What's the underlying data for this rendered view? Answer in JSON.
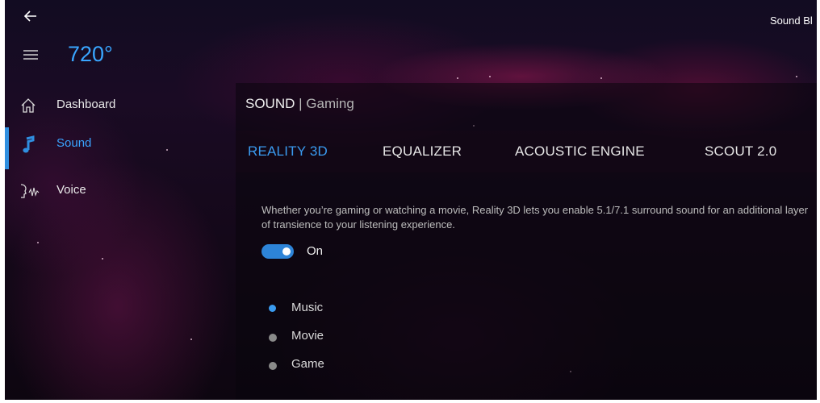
{
  "titlebar": {
    "app_title": "Sound Bl",
    "back_icon": "back-arrow-icon"
  },
  "header": {
    "brand": "720°",
    "menu_icon": "hamburger-menu-icon"
  },
  "sidebar": {
    "items": [
      {
        "label": "Dashboard",
        "icon": "home-icon",
        "active": false
      },
      {
        "label": "Sound",
        "icon": "music-note-icon",
        "active": true
      },
      {
        "label": "Voice",
        "icon": "voice-icon",
        "active": false
      }
    ]
  },
  "main": {
    "breadcrumb": {
      "section": "SOUND",
      "separator": "|",
      "profile": "Gaming"
    },
    "tabs": [
      {
        "label": "REALITY 3D",
        "active": true
      },
      {
        "label": "EQUALIZER",
        "active": false
      },
      {
        "label": "ACOUSTIC ENGINE",
        "active": false
      },
      {
        "label": "SCOUT 2.0",
        "active": false
      }
    ],
    "description": "Whether you’re gaming or watching a movie, Reality 3D lets you enable 5.1/7.1 surround sound for an additional layer of transience to your listening experience.",
    "toggle": {
      "state": "On",
      "on": true
    },
    "modes": [
      {
        "label": "Music",
        "selected": true
      },
      {
        "label": "Movie",
        "selected": false
      },
      {
        "label": "Game",
        "selected": false
      }
    ]
  },
  "colors": {
    "accent": "#3a9bf0",
    "brand": "#39a6ff",
    "background": "#140819"
  }
}
